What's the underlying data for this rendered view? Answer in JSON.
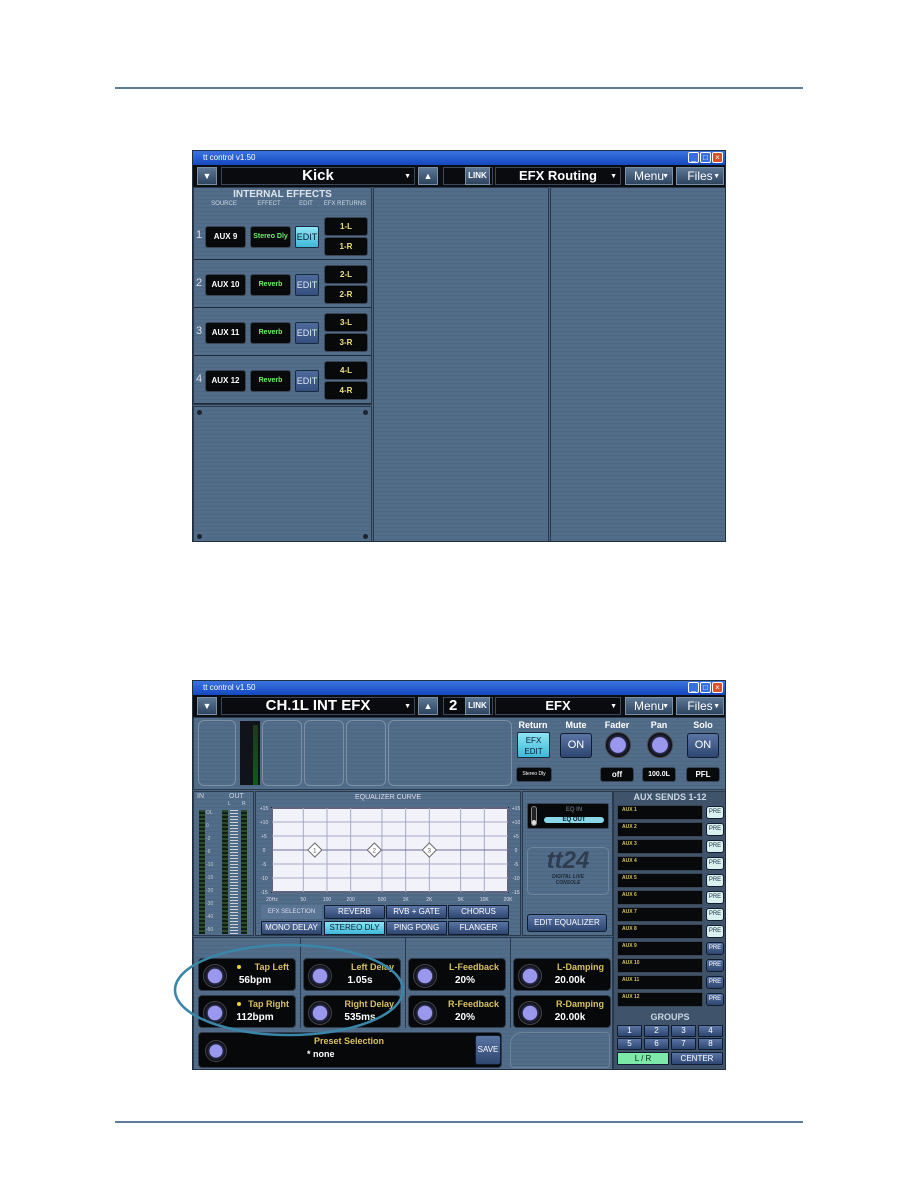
{
  "shot1": {
    "title": "tt control  v1.50",
    "channel": "Kick",
    "link": "LINK",
    "view": "EFX Routing",
    "menu": "Menu",
    "files": "Files",
    "header": "INTERNAL EFFECTS",
    "cols": [
      "SOURCE",
      "EFFECT",
      "EDIT",
      "EFX RETURNS"
    ],
    "rows": [
      {
        "num": "1",
        "source": "AUX 9",
        "effect": "Stereo Dly",
        "edit": "EDIT",
        "ret_l": "1-L",
        "ret_r": "1-R",
        "active": true
      },
      {
        "num": "2",
        "source": "AUX 10",
        "effect": "Reverb",
        "edit": "EDIT",
        "ret_l": "2-L",
        "ret_r": "2-R"
      },
      {
        "num": "3",
        "source": "AUX 11",
        "effect": "Reverb",
        "edit": "EDIT",
        "ret_l": "3-L",
        "ret_r": "3-R"
      },
      {
        "num": "4",
        "source": "AUX 12",
        "effect": "Reverb",
        "edit": "EDIT",
        "ret_l": "4-L",
        "ret_r": "4-R"
      }
    ]
  },
  "shot2": {
    "title": "tt control  v1.50",
    "channel": "CH.1L INT EFX",
    "number": "2",
    "link": "LINK",
    "view": "EFX",
    "menu": "Menu",
    "files": "Files",
    "strip": {
      "return": "Return",
      "efx_edit": "EFX EDIT",
      "effect_name": "Stereo Dly",
      "mute": "Mute",
      "mute_btn": "ON",
      "fader": "Fader",
      "fader_val": "off",
      "pan": "Pan",
      "pan_val": "100.0L",
      "solo": "Solo",
      "solo_btn": "ON",
      "solo_mode": "PFL"
    },
    "meters": {
      "in": "IN",
      "out": "OUT",
      "l": "L",
      "r": "R",
      "scale": [
        "OL",
        "0",
        "-2",
        "-6",
        "-10",
        "-15",
        "-20",
        "-30",
        "-40",
        "-50"
      ]
    },
    "eq": {
      "title": "EQUALIZER CURVE",
      "y_ticks": [
        "+15",
        "+10",
        "+5",
        "0",
        "-5",
        "-10",
        "-15"
      ],
      "x_ticks": [
        "20Hz",
        "50",
        "100",
        "200",
        "500",
        "1K",
        "2K",
        "5K",
        "10K",
        "20K"
      ],
      "bands": [
        {
          "label": "1",
          "freq": "70"
        },
        {
          "label": "2",
          "freq": "400"
        },
        {
          "label": "3",
          "freq": "2K"
        }
      ],
      "eq_in": "EQ IN",
      "eq_out": "EQ OUT",
      "edit": "EDIT EQUALIZER"
    },
    "logo": {
      "text": "tt24",
      "sub1": "DIGITAL LIVE",
      "sub2": "CONSOLE"
    },
    "efx_selection": {
      "label": "EFX SELECTION",
      "buttons": [
        "REVERB",
        "RVB + GATE",
        "CHORUS",
        "MONO DELAY",
        "STEREO DLY",
        "PING PONG",
        "FLANGER"
      ],
      "selected": "STEREO DLY"
    },
    "aux": {
      "title": "AUX SENDS 1-12",
      "items": [
        "AUX 1",
        "AUX 2",
        "AUX 3",
        "AUX 4",
        "AUX 5",
        "AUX 6",
        "AUX 7",
        "AUX 8",
        "AUX 9",
        "AUX 10",
        "AUX 11",
        "AUX 12"
      ],
      "pre": "PRE",
      "pre_highlighted_count": 8
    },
    "groups": {
      "title": "GROUPS",
      "buttons": [
        "1",
        "2",
        "3",
        "4",
        "5",
        "6",
        "7",
        "8"
      ],
      "lr": "L / R",
      "center": "CENTER"
    },
    "params": [
      {
        "name": "Tap Left",
        "value": "56bpm",
        "dot": true
      },
      {
        "name": "Left Delay",
        "value": "1.05s"
      },
      {
        "name": "L-Feedback",
        "value": "20%"
      },
      {
        "name": "L-Damping",
        "value": "20.00k"
      },
      {
        "name": "Tap Right",
        "value": "112bpm",
        "dot": true
      },
      {
        "name": "Right Delay",
        "value": "535ms"
      },
      {
        "name": "R-Feedback",
        "value": "20%"
      },
      {
        "name": "R-Damping",
        "value": "20.00k"
      }
    ],
    "preset": {
      "label": "Preset Selection",
      "value": "* none",
      "save": "SAVE"
    },
    "colors": {
      "annotation": "#3a86a8",
      "accent": "#4fc6e0",
      "panel": "#4b6580"
    }
  }
}
